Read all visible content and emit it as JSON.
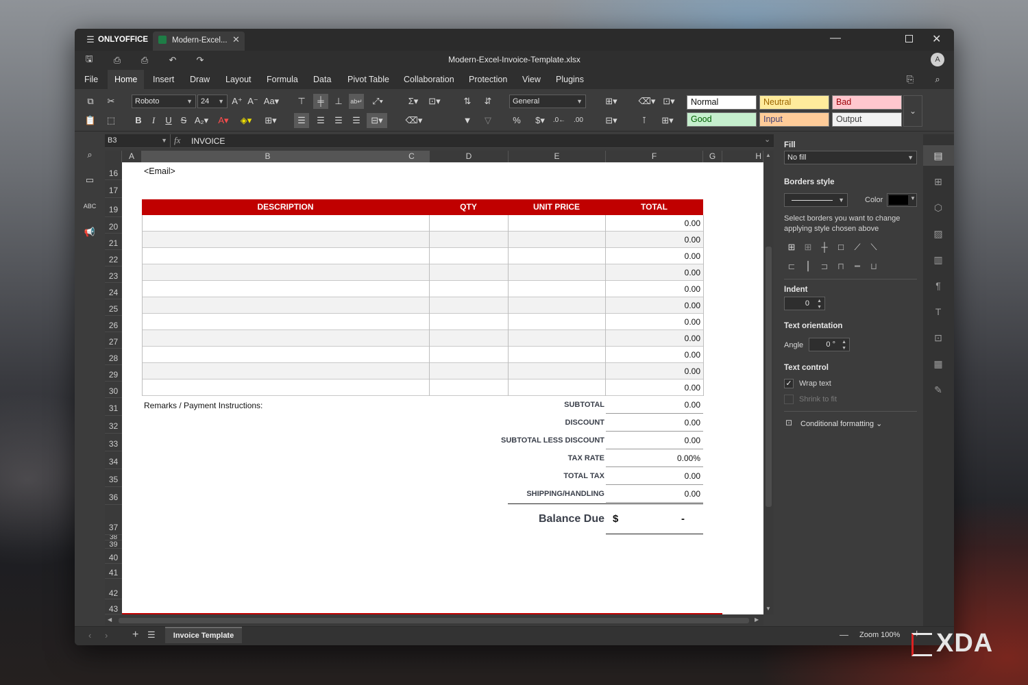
{
  "app": {
    "name": "ONLYOFFICE",
    "doc_tab": "Modern-Excel...",
    "file_title": "Modern-Excel-Invoice-Template.xlsx",
    "avatar": "A"
  },
  "menu": [
    "File",
    "Home",
    "Insert",
    "Draw",
    "Layout",
    "Formula",
    "Data",
    "Pivot Table",
    "Collaboration",
    "Protection",
    "View",
    "Plugins"
  ],
  "toolbar": {
    "font": "Roboto",
    "size": "24",
    "number_format": "General",
    "styles": [
      {
        "label": "Normal",
        "bg": "#ffffff",
        "fg": "#111111"
      },
      {
        "label": "Neutral",
        "bg": "#ffeb9c",
        "fg": "#9c6500"
      },
      {
        "label": "Bad",
        "bg": "#ffc7ce",
        "fg": "#9c0006"
      },
      {
        "label": "Good",
        "bg": "#c6efce",
        "fg": "#006100"
      },
      {
        "label": "Input",
        "bg": "#ffcc99",
        "fg": "#3f3f76"
      },
      {
        "label": "Output",
        "bg": "#f2f2f2",
        "fg": "#3f3f3f"
      }
    ]
  },
  "formula_bar": {
    "cell_ref": "B3",
    "fx": "fx",
    "value": "INVOICE"
  },
  "columns": [
    "A",
    "B",
    "C",
    "D",
    "E",
    "F",
    "G",
    "H"
  ],
  "rows": [
    "16",
    "17",
    "19",
    "20",
    "21",
    "22",
    "23",
    "24",
    "25",
    "26",
    "27",
    "28",
    "29",
    "30",
    "31",
    "32",
    "33",
    "34",
    "35",
    "36",
    "37",
    "38",
    "39",
    "40",
    "41",
    "42",
    "43"
  ],
  "sheet": {
    "email": "<Email>",
    "headers": {
      "description": "DESCRIPTION",
      "qty": "QTY",
      "unit_price": "UNIT PRICE",
      "total": "TOTAL"
    },
    "line_totals": [
      "0.00",
      "0.00",
      "0.00",
      "0.00",
      "0.00",
      "0.00",
      "0.00",
      "0.00",
      "0.00",
      "0.00",
      "0.00"
    ],
    "remarks": "Remarks / Payment Instructions:",
    "summary": [
      {
        "label": "SUBTOTAL",
        "value": "0.00"
      },
      {
        "label": "DISCOUNT",
        "value": "0.00"
      },
      {
        "label": "SUBTOTAL LESS DISCOUNT",
        "value": "0.00"
      },
      {
        "label": "TAX RATE",
        "value": "0.00%"
      },
      {
        "label": "TOTAL TAX",
        "value": "0.00"
      },
      {
        "label": "SHIPPING/HANDLING",
        "value": "0.00"
      }
    ],
    "balance_label": "Balance Due",
    "balance_currency": "$",
    "balance_value": "-",
    "accent": "#c00000"
  },
  "panel": {
    "fill_title": "Fill",
    "fill_value": "No fill",
    "borders_title": "Borders style",
    "color_label": "Color",
    "borders_hint": "Select borders you want to change applying style chosen above",
    "indent_title": "Indent",
    "indent_value": "0",
    "orientation_title": "Text orientation",
    "angle_label": "Angle",
    "angle_value": "0 °",
    "text_control_title": "Text control",
    "wrap_text": "Wrap text",
    "shrink_to_fit": "Shrink to fit",
    "conditional_formatting": "Conditional formatting"
  },
  "status": {
    "sheet_tab": "Invoice Template",
    "zoom": "Zoom 100%"
  },
  "watermark": "XDA"
}
